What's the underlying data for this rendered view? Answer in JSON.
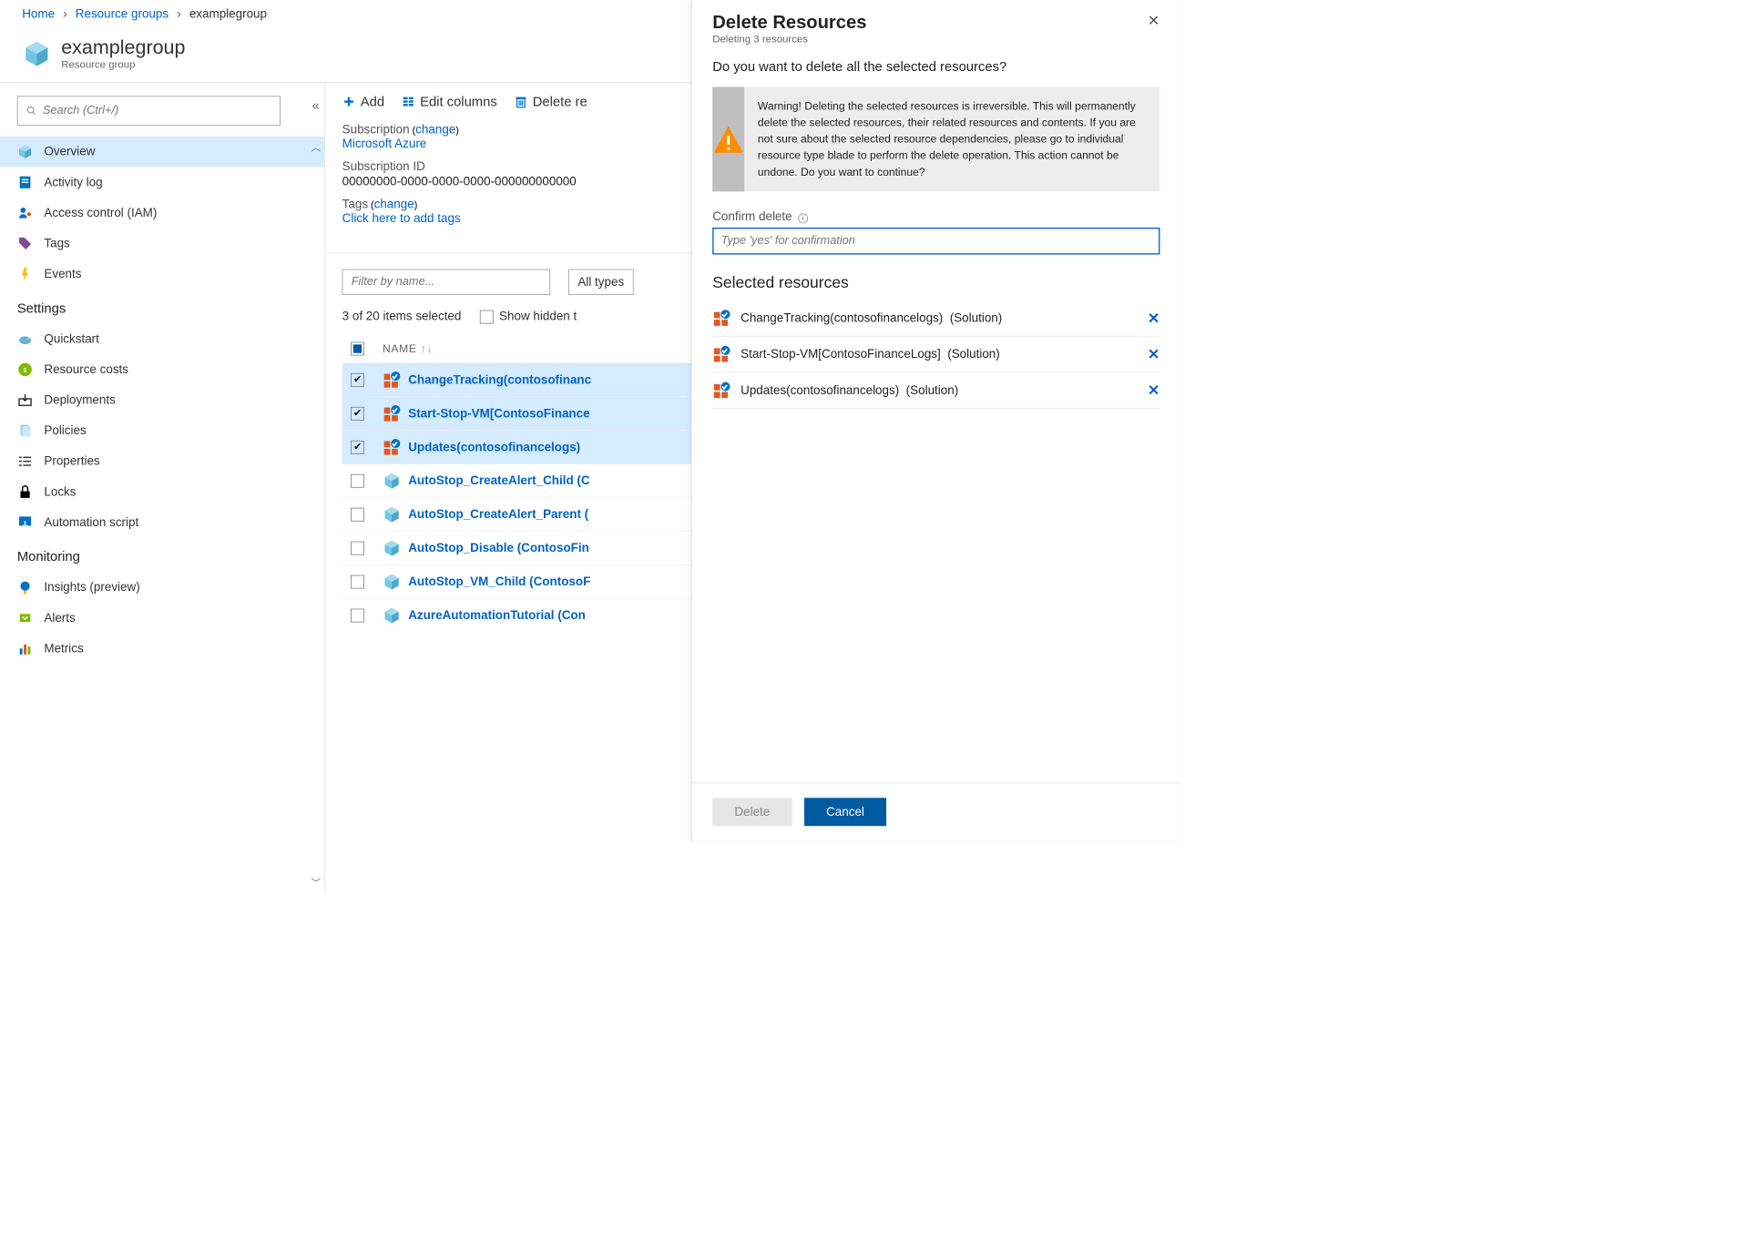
{
  "breadcrumb": {
    "home": "Home",
    "rg": "Resource groups",
    "current": "examplegroup"
  },
  "header": {
    "title": "examplegroup",
    "subtitle": "Resource group"
  },
  "search": {
    "placeholder": "Search (Ctrl+/)"
  },
  "nav": {
    "overview": "Overview",
    "activity": "Activity log",
    "iam": "Access control (IAM)",
    "tags": "Tags",
    "events": "Events",
    "settings_header": "Settings",
    "quickstart": "Quickstart",
    "costs": "Resource costs",
    "deployments": "Deployments",
    "policies": "Policies",
    "properties": "Properties",
    "locks": "Locks",
    "automation": "Automation script",
    "monitoring_header": "Monitoring",
    "insights": "Insights (preview)",
    "alerts": "Alerts",
    "metrics": "Metrics"
  },
  "toolbar": {
    "add": "Add",
    "edit": "Edit columns",
    "delete": "Delete re"
  },
  "details": {
    "sub_label": "Subscription",
    "sub_change": "change",
    "sub_value": "Microsoft Azure",
    "subid_label": "Subscription ID",
    "subid_value": "00000000-0000-0000-0000-000000000000",
    "tags_label": "Tags",
    "tags_change": "change",
    "tags_value": "Click here to add tags"
  },
  "filter": {
    "placeholder": "Filter by name...",
    "types": "All types"
  },
  "selection_text": "3 of 20 items selected",
  "show_hidden": "Show hidden t",
  "table_head": "NAME",
  "resources": [
    {
      "name": "ChangeTracking(contosofinanc",
      "selected": true,
      "type": "solution"
    },
    {
      "name": "Start-Stop-VM[ContosoFinance",
      "selected": true,
      "type": "solution"
    },
    {
      "name": "Updates(contosofinancelogs)",
      "selected": true,
      "type": "solution"
    },
    {
      "name": "AutoStop_CreateAlert_Child (C",
      "selected": false,
      "type": "cube"
    },
    {
      "name": "AutoStop_CreateAlert_Parent (",
      "selected": false,
      "type": "cube"
    },
    {
      "name": "AutoStop_Disable (ContosoFin",
      "selected": false,
      "type": "cube"
    },
    {
      "name": "AutoStop_VM_Child (ContosoF",
      "selected": false,
      "type": "cube"
    },
    {
      "name": "AzureAutomationTutorial (Con",
      "selected": false,
      "type": "cube"
    }
  ],
  "panel": {
    "title": "Delete Resources",
    "subtitle": "Deleting 3 resources",
    "question": "Do you want to delete all the selected resources?",
    "warning": "Warning! Deleting the selected resources is irreversible. This will permanently delete the selected resources, their related resources and contents. If you are not sure about the selected resource dependencies, please go to individual resource type blade to perform the delete operation. This action cannot be undone. Do you want to continue?",
    "confirm_label": "Confirm delete",
    "confirm_placeholder": "Type 'yes' for confirmation",
    "selected_title": "Selected resources",
    "selected": [
      {
        "name": "ChangeTracking(contosofinancelogs)",
        "type": "(Solution)"
      },
      {
        "name": "Start-Stop-VM[ContosoFinanceLogs]",
        "type": "(Solution)"
      },
      {
        "name": "Updates(contosofinancelogs)",
        "type": "(Solution)"
      }
    ],
    "delete_btn": "Delete",
    "cancel_btn": "Cancel"
  }
}
